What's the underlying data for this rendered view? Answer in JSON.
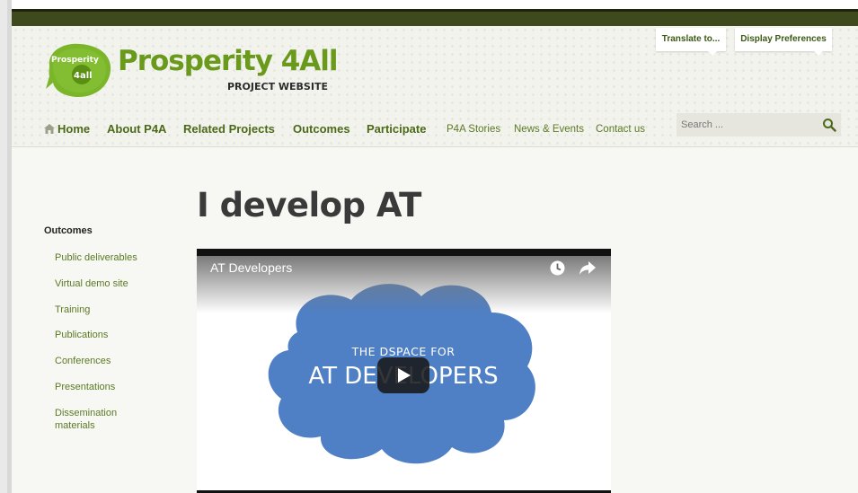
{
  "brand": {
    "badge_line1": "Prosperity",
    "badge_line2": "4all",
    "title": "Prosperity 4All",
    "subtitle": "PROJECT WEBSITE"
  },
  "top_tabs": {
    "translate": "Translate to...",
    "display": "Display Preferences"
  },
  "nav": {
    "home": "Home",
    "about": "About P4A",
    "related": "Related Projects",
    "outcomes": "Outcomes",
    "participate": "Participate",
    "stories": "P4A Stories",
    "news": "News & Events",
    "contact": "Contact us"
  },
  "search": {
    "placeholder": "Search ..."
  },
  "sidebar": {
    "heading": "Outcomes",
    "items": [
      "Public deliverables",
      "Virtual demo site",
      "Training",
      "Publications",
      "Conferences",
      "Presentations",
      "Dissemination materials"
    ]
  },
  "page": {
    "title": "I develop AT"
  },
  "video": {
    "title": "AT Developers",
    "line1": "THE DSPACE FOR",
    "line2": "AT DEVELOPERS"
  },
  "colors": {
    "brand_green": "#6a9a1c",
    "nav_green": "#4b6a18",
    "top_bar": "#3e4a1c",
    "cloud_blue": "#4f7fc4"
  }
}
